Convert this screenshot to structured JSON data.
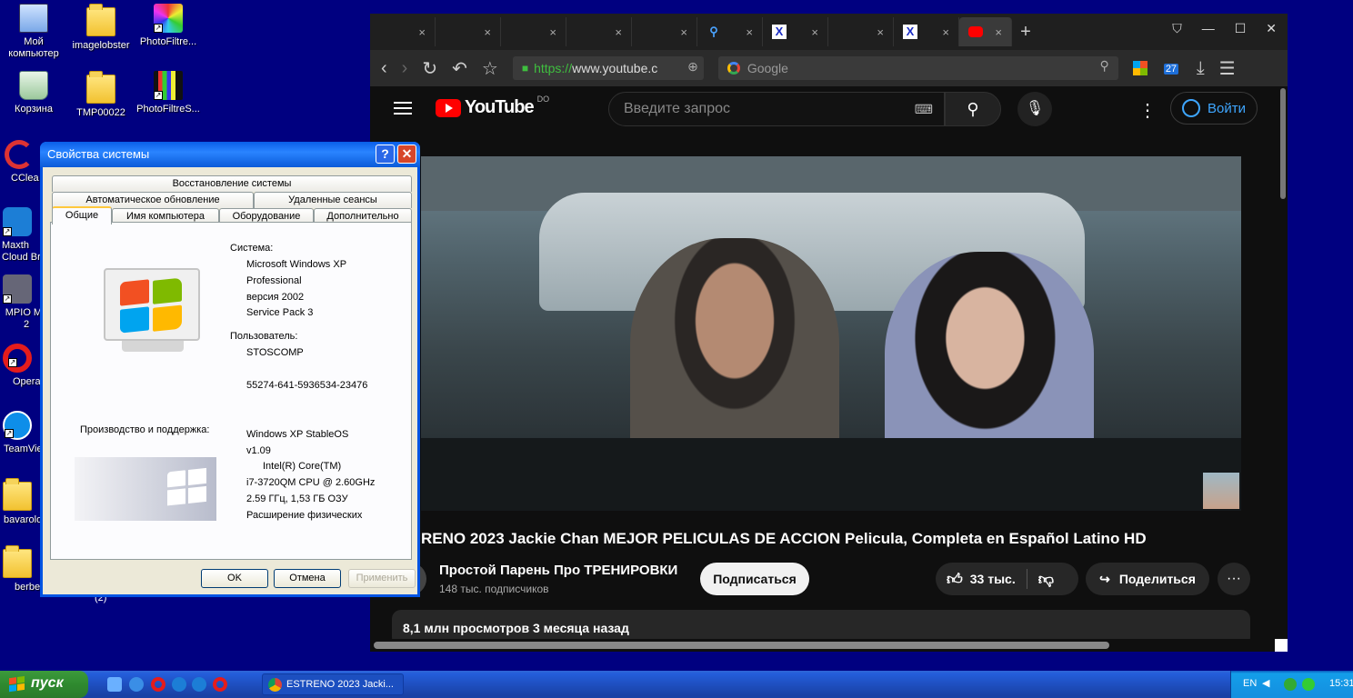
{
  "desktop": {
    "icons": [
      {
        "label": "Мой компьютер"
      },
      {
        "label": "imagelobster"
      },
      {
        "label": "PhotoFiltre..."
      },
      {
        "label": "Корзина"
      },
      {
        "label": "TMP00022"
      },
      {
        "label": "PhotoFiltreS..."
      },
      {
        "label": "CClea"
      },
      {
        "label": "Maxth Cloud Bro"
      },
      {
        "label": "MPIO Ma 2"
      },
      {
        "label": "Opera"
      },
      {
        "label": "TeamVie"
      },
      {
        "label": "bavarolo"
      },
      {
        "label": "berbe"
      }
    ],
    "stray_text": "(2)"
  },
  "browser": {
    "tabs": [
      {
        "icon": "",
        "close": "×"
      },
      {
        "icon": "",
        "close": "×"
      },
      {
        "icon": "",
        "close": "×"
      },
      {
        "icon": "",
        "close": "×"
      },
      {
        "icon": "",
        "close": "×"
      },
      {
        "icon": "search-icon",
        "close": "×"
      },
      {
        "icon": "x-icon",
        "close": "×"
      },
      {
        "icon": "",
        "close": "×"
      },
      {
        "icon": "x-icon",
        "close": "×"
      },
      {
        "icon": "youtube-icon",
        "close": "×"
      }
    ],
    "new_tab": "+",
    "url_scheme": "https://",
    "url_host": "www.youtube.c",
    "search_engine": "Google",
    "notification_count": "27"
  },
  "youtube": {
    "logo_text": "YouTube",
    "region": "DO",
    "search_placeholder": "Введите запрос",
    "login_label": "Войти",
    "video_title": "RENO 2023 Jackie Chan MEJOR PELICULAS DE ACCION Pelicula, Completa en Español Latino HD",
    "channel_name": "Простой Парень Про ТРЕНИРОВКИ",
    "channel_subs": "148 тыс. подписчиков",
    "subscribe_label": "Подписаться",
    "likes": "33 тыс.",
    "share_label": "Поделиться",
    "views_date": "8,1 млн просмотров  3 месяца назад"
  },
  "dialog": {
    "title": "Свойства системы",
    "tabs_row1": [
      "Восстановление системы"
    ],
    "tabs_row2": [
      "Автоматическое обновление",
      "Удаленные сеансы"
    ],
    "tabs_row3": [
      "Общие",
      "Имя компьютера",
      "Оборудование",
      "Дополнительно"
    ],
    "system_label": "Система:",
    "system_lines": [
      "Microsoft Windows XP",
      "Professional",
      "версия 2002",
      "Service Pack 3"
    ],
    "user_label": "Пользователь:",
    "user_name": "STOSCOMP",
    "product_id": "55274-641-5936534-23476",
    "support_label": "Производство и поддержка:",
    "support_lines": [
      "Windows XP StableOS",
      "v1.09",
      "Intel(R) Core(TM)",
      "i7-3720QM CPU @ 2.60GHz",
      "2.59 ГГц, 1,53 ГБ ОЗУ",
      "Расширение физических"
    ],
    "ok": "OK",
    "cancel": "Отмена",
    "apply": "Применить"
  },
  "taskbar": {
    "start_label": "пуск",
    "task_title": "ESTRENO 2023 Jacki...",
    "lang": "EN",
    "clock": "15:31"
  }
}
